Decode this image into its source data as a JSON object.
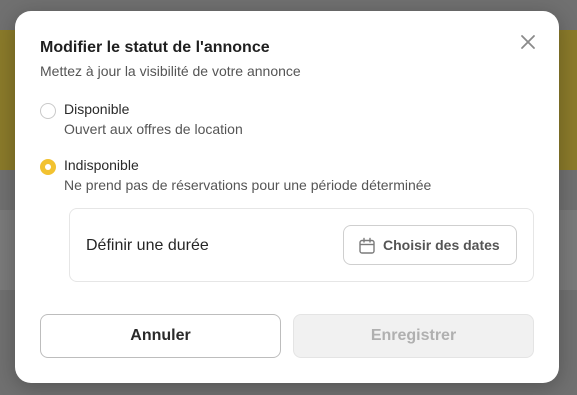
{
  "modal": {
    "title": "Modifier le statut de l'annonce",
    "subtitle": "Mettez à jour la visibilité de votre annonce",
    "close_icon": "close-icon"
  },
  "options": [
    {
      "label": "Disponible",
      "description": "Ouvert aux offres de location",
      "selected": false
    },
    {
      "label": "Indisponible",
      "description": "Ne prend pas de réservations pour une période déterminée",
      "selected": true
    }
  ],
  "duration": {
    "label": "Définir une durée",
    "button_label": "Choisir des dates",
    "button_icon": "calendar-icon"
  },
  "actions": {
    "cancel_label": "Annuler",
    "save_label": "Enregistrer",
    "save_enabled": false
  },
  "colors": {
    "accent": "#f2c230",
    "overlay": "#707070"
  }
}
